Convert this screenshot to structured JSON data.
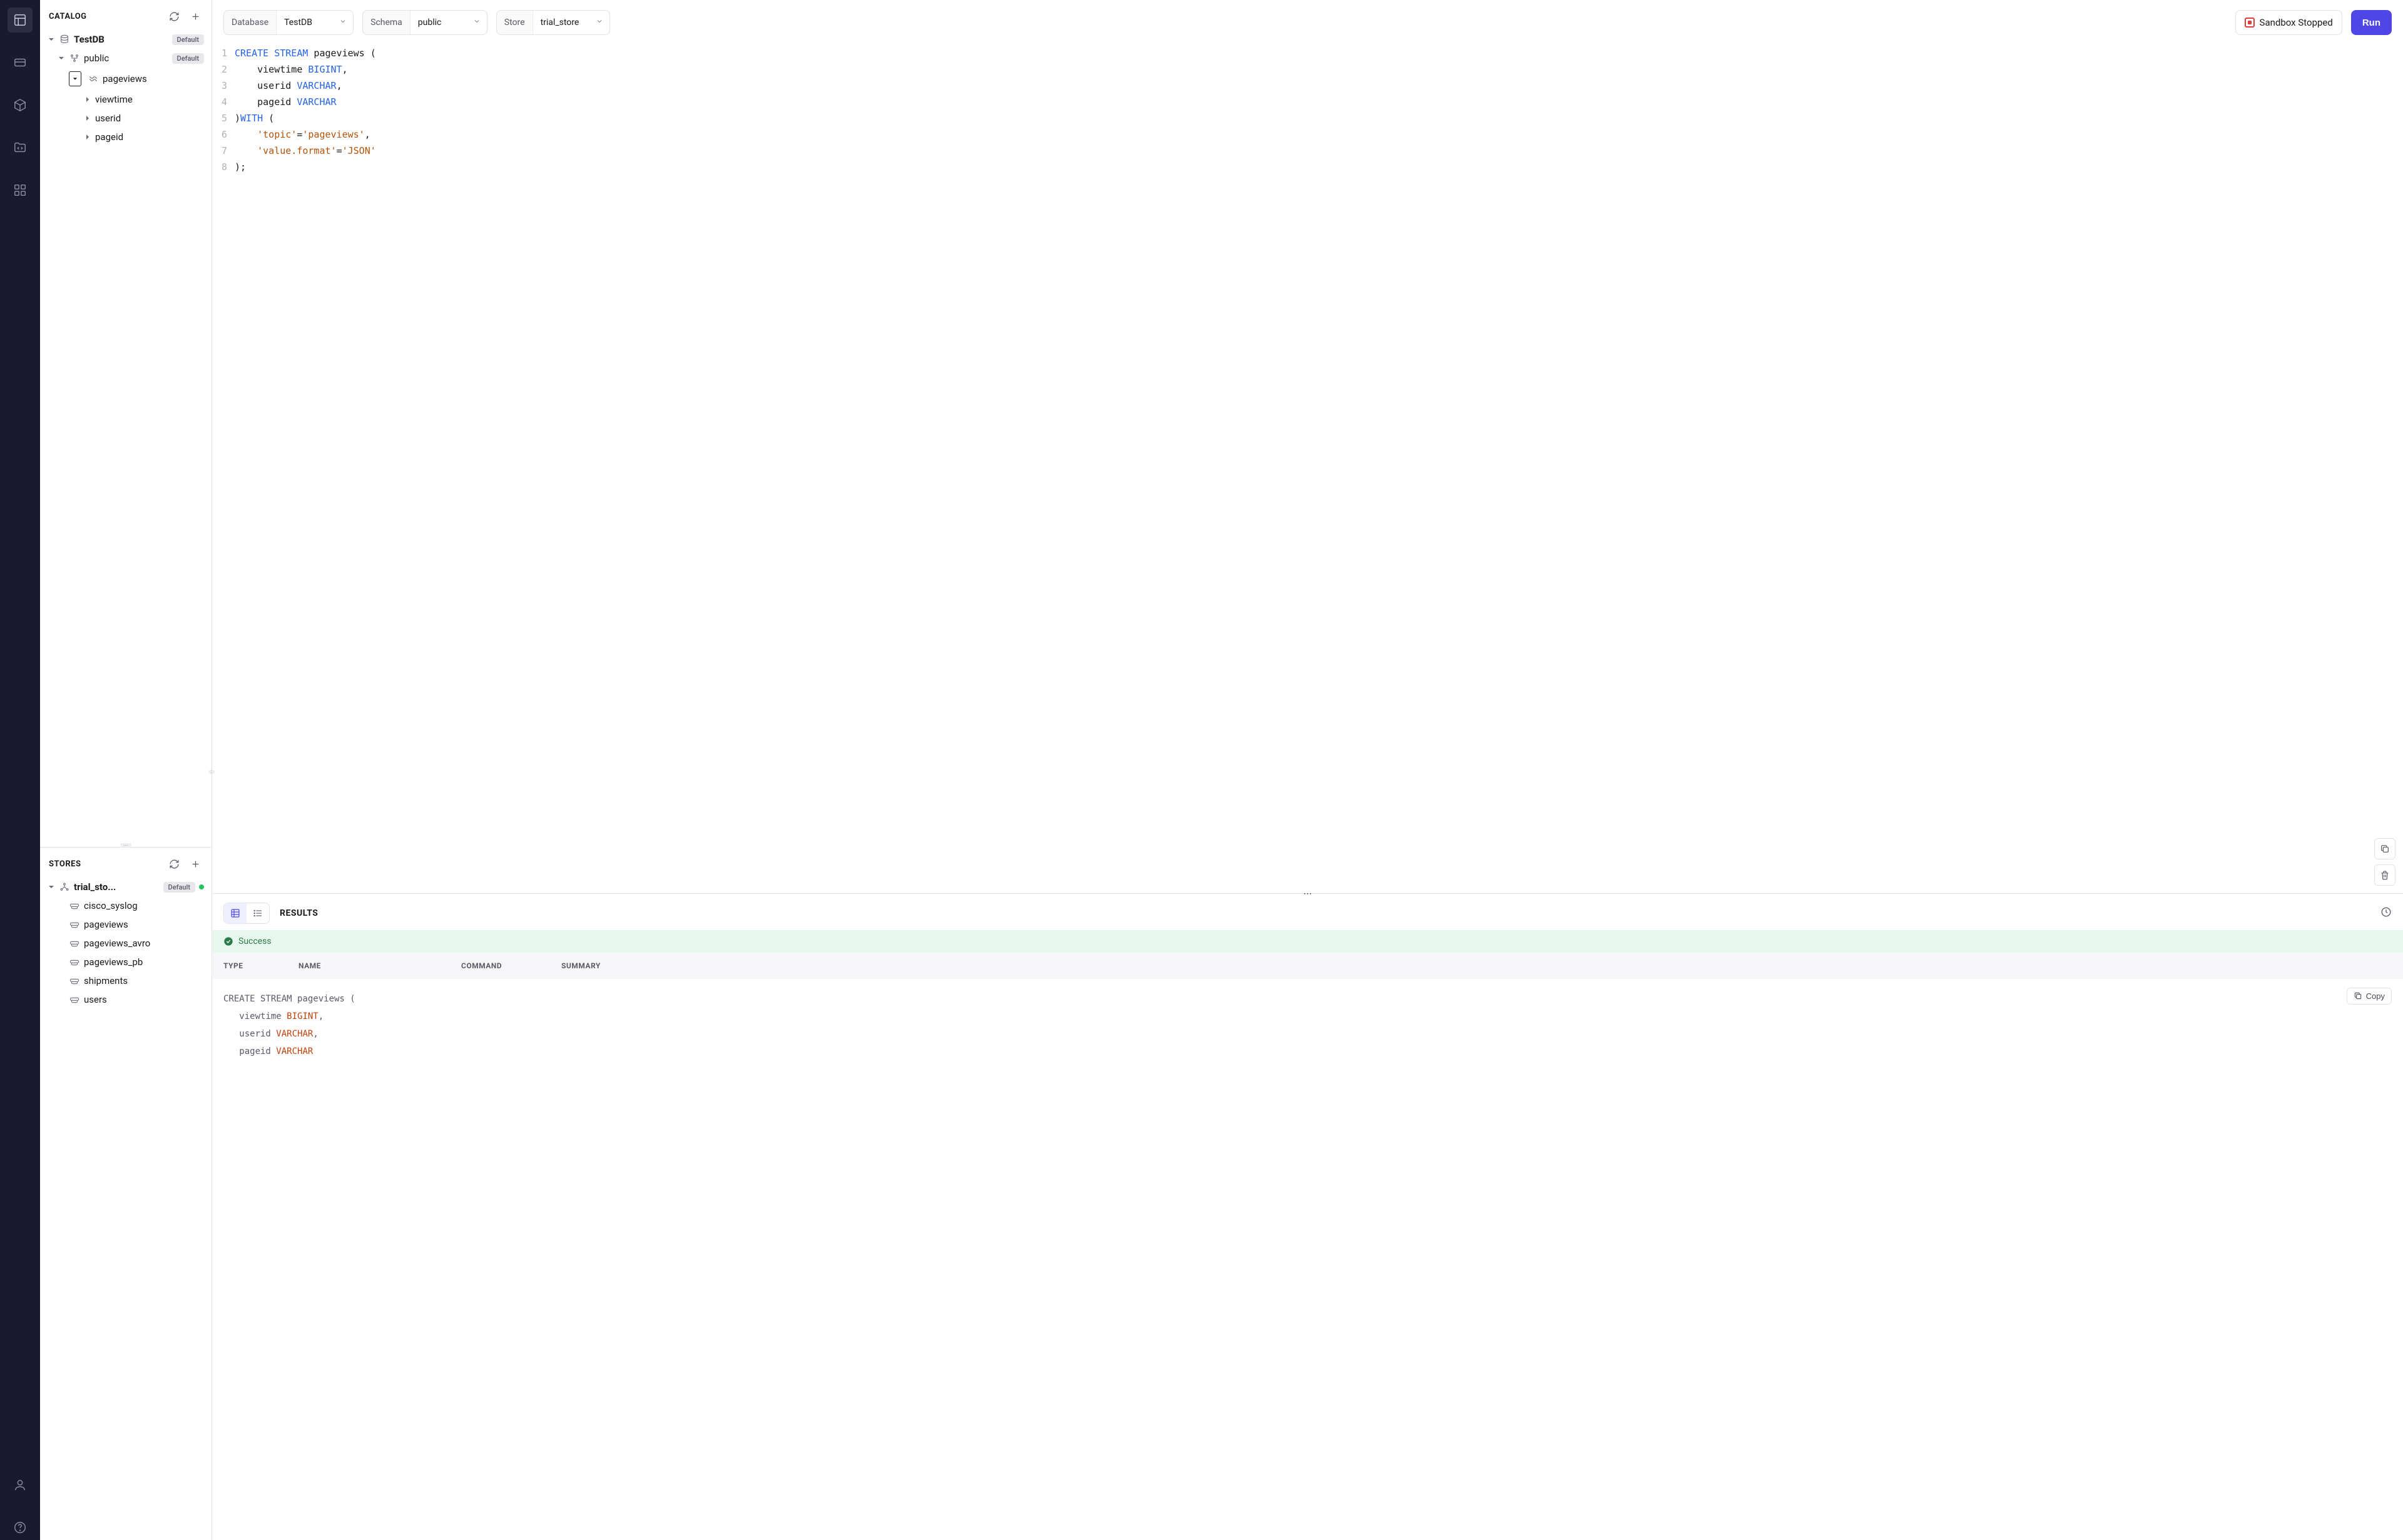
{
  "catalog": {
    "title": "CATALOG",
    "database": {
      "name": "TestDB",
      "badge": "Default"
    },
    "schema": {
      "name": "public",
      "badge": "Default"
    },
    "stream": {
      "name": "pageviews"
    },
    "columns": [
      "viewtime",
      "userid",
      "pageid"
    ]
  },
  "stores": {
    "title": "STORES",
    "store": {
      "name": "trial_sto...",
      "badge": "Default"
    },
    "topics": [
      "cisco_syslog",
      "pageviews",
      "pageviews_avro",
      "pageviews_pb",
      "shipments",
      "users"
    ]
  },
  "toolbar": {
    "database_label": "Database",
    "database_value": "TestDB",
    "schema_label": "Schema",
    "schema_value": "public",
    "store_label": "Store",
    "store_value": "trial_store",
    "status": "Sandbox Stopped",
    "run": "Run"
  },
  "editor": {
    "lines": [
      [
        {
          "t": "CREATE",
          "c": "kw-blue"
        },
        {
          "t": " "
        },
        {
          "t": "STREAM",
          "c": "kw-blue"
        },
        {
          "t": " pageviews ("
        }
      ],
      [
        {
          "t": "    viewtime "
        },
        {
          "t": "BIGINT",
          "c": "kw-type"
        },
        {
          "t": ","
        }
      ],
      [
        {
          "t": "    userid "
        },
        {
          "t": "VARCHAR",
          "c": "kw-type"
        },
        {
          "t": ","
        }
      ],
      [
        {
          "t": "    pageid "
        },
        {
          "t": "VARCHAR",
          "c": "kw-type"
        }
      ],
      [
        {
          "t": ")"
        },
        {
          "t": "WITH",
          "c": "kw-with"
        },
        {
          "t": " ("
        }
      ],
      [
        {
          "t": "    "
        },
        {
          "t": "'topic'",
          "c": "str"
        },
        {
          "t": "="
        },
        {
          "t": "'pageviews'",
          "c": "str"
        },
        {
          "t": ","
        }
      ],
      [
        {
          "t": "    "
        },
        {
          "t": "'value.format'",
          "c": "str"
        },
        {
          "t": "="
        },
        {
          "t": "'JSON'",
          "c": "str"
        }
      ],
      [
        {
          "t": ");"
        }
      ]
    ]
  },
  "results": {
    "title": "RESULTS",
    "success": "Success",
    "columns": {
      "type": "TYPE",
      "name": "NAME",
      "command": "COMMAND",
      "summary": "SUMMARY"
    },
    "copy": "Copy",
    "code_lines": [
      [
        {
          "t": "CREATE"
        },
        {
          "t": " STREAM pageviews ("
        }
      ],
      [
        {
          "t": "   viewtime "
        },
        {
          "t": "BIGINT",
          "c": "ty"
        },
        {
          "t": ","
        }
      ],
      [
        {
          "t": "   userid "
        },
        {
          "t": "VARCHAR",
          "c": "ty"
        },
        {
          "t": ","
        }
      ],
      [
        {
          "t": "   pageid "
        },
        {
          "t": "VARCHAR",
          "c": "ty"
        }
      ]
    ]
  }
}
